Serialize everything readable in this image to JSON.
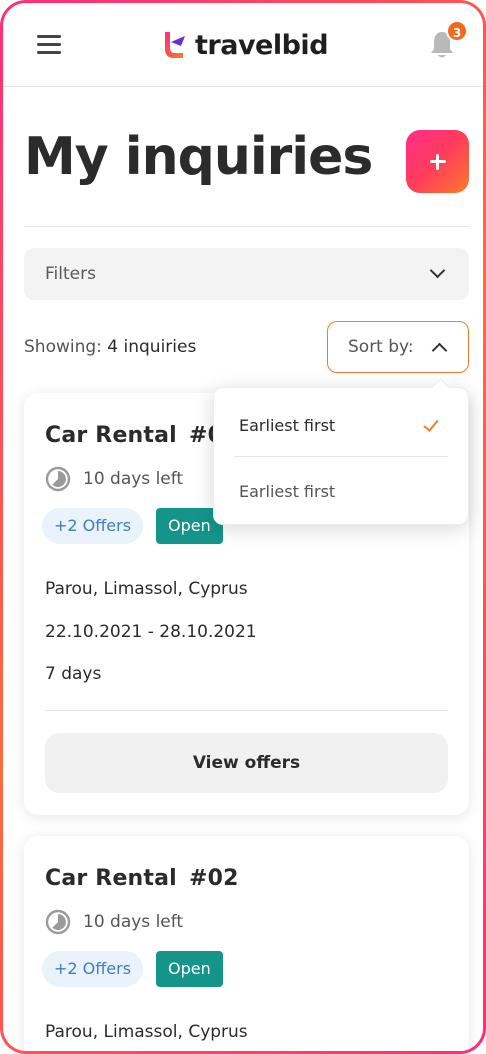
{
  "header": {
    "brand": "travelbid",
    "notification_count": "3",
    "brand_colors": {
      "pink": "#ff2d7a",
      "orange": "#ff7a2a",
      "purple": "#6b2fd6"
    }
  },
  "page": {
    "title": "My inquiries",
    "add_button_icon": "plus-icon"
  },
  "filters": {
    "label": "Filters"
  },
  "results": {
    "showing_label": "Showing:",
    "showing_value": "4 inquiries"
  },
  "sort": {
    "label": "Sort by:",
    "options": [
      {
        "label": "Earliest first",
        "selected": true
      },
      {
        "label": "Earliest first",
        "selected": false
      }
    ]
  },
  "inquiries": [
    {
      "title": "Car Rental",
      "number": "#01",
      "time_left": "10 days left",
      "offers": "+2 Offers",
      "status": "Open",
      "location": "Parou, Limassol, Cyprus",
      "dates": "22.10.2021 - 28.10.2021",
      "duration": "7 days",
      "action": "View offers"
    },
    {
      "title": "Car Rental",
      "number": "#02",
      "time_left": "10 days left",
      "offers": "+2 Offers",
      "status": "Open",
      "location": "Parou, Limassol, Cyprus"
    }
  ],
  "colors": {
    "accent": "#f07a2e",
    "status_open": "#15958a",
    "offers_text": "#3d7ec4"
  }
}
